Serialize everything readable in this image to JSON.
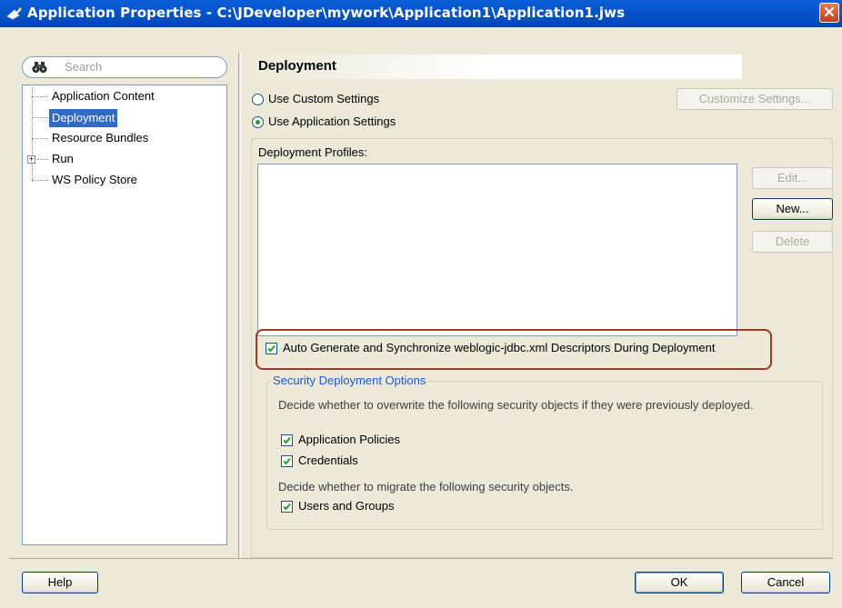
{
  "window": {
    "title": "Application Properties - C:\\JDeveloper\\mywork\\Application1\\Application1.jws",
    "close_label": "X"
  },
  "search": {
    "placeholder": "Search"
  },
  "tree": {
    "items": [
      {
        "label": "Application Content",
        "selected": false
      },
      {
        "label": "Deployment",
        "selected": true
      },
      {
        "label": "Resource Bundles",
        "selected": false
      },
      {
        "label": "Run",
        "selected": false,
        "expandable": true,
        "expander": "+"
      },
      {
        "label": "WS Policy Store",
        "selected": false
      }
    ]
  },
  "section": {
    "title": "Deployment"
  },
  "settings": {
    "custom_label": "Use Custom Settings",
    "custom_mnemonic": "C",
    "app_label": "Use Application Settings",
    "app_mnemonic": "U",
    "selected": "app",
    "customize_button": "Customize Settings..."
  },
  "profiles": {
    "label": "Deployment Profiles:",
    "items": [],
    "edit_button": "Edit...",
    "new_button": "New...",
    "delete_button": "Delete"
  },
  "auto_generate": {
    "label": "Auto Generate and Synchronize weblogic-jdbc.xml Descriptors During Deployment",
    "checked": true
  },
  "security": {
    "title": "Security Deployment Options",
    "desc1": "Decide whether to overwrite the following security objects if they were previously deployed.",
    "policies_label": "Application Policies",
    "policies_checked": true,
    "credentials_label": "Credentials",
    "credentials_checked": true,
    "desc2": "Decide whether to migrate the following security objects.",
    "users_label": "Users and Groups",
    "users_checked": true
  },
  "footer": {
    "help_button": "Help",
    "ok_button": "OK",
    "cancel_button": "Cancel"
  },
  "colors": {
    "title_bar": "#0553c8",
    "selection": "#316ac5",
    "highlight_border": "#9c3a23",
    "security_title": "#2257cf"
  }
}
